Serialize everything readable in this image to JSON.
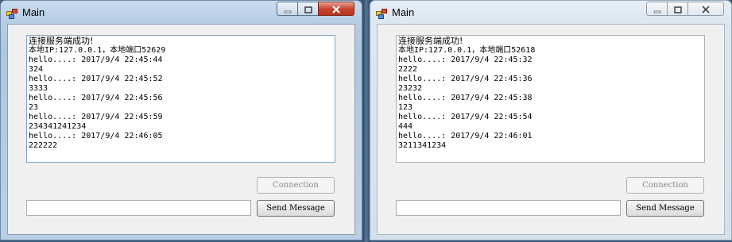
{
  "windows": [
    {
      "title": "Main",
      "log": {
        "header_lines": [
          "连接服务端成功!",
          "本地IP:127.0.0.1，本地端口52629"
        ],
        "messages": [
          {
            "time_line": "hello....: 2017/9/4 22:45:44",
            "body": "324"
          },
          {
            "time_line": "hello....: 2017/9/4 22:45:52",
            "body": "3333"
          },
          {
            "time_line": "hello....: 2017/9/4 22:45:56",
            "body": "23"
          },
          {
            "time_line": "hello....: 2017/9/4 22:45:59",
            "body": "234341241234"
          },
          {
            "time_line": "hello....: 2017/9/4 22:46:05",
            "body": "222222"
          }
        ]
      },
      "connection_button": "Connection",
      "send_button": "Send Message",
      "message_input": "",
      "active": true
    },
    {
      "title": "Main",
      "log": {
        "header_lines": [
          "连接服务端成功!",
          "本地IP:127.0.0.1，本地端口52618"
        ],
        "messages": [
          {
            "time_line": "hello....: 2017/9/4 22:45:32",
            "body": "2222"
          },
          {
            "time_line": "hello....: 2017/9/4 22:45:36",
            "body": "23232"
          },
          {
            "time_line": "hello....: 2017/9/4 22:45:38",
            "body": "123"
          },
          {
            "time_line": "hello....: 2017/9/4 22:45:54",
            "body": "444"
          },
          {
            "time_line": "hello....: 2017/9/4 22:46:01",
            "body": "3211341234"
          }
        ]
      },
      "connection_button": "Connection",
      "send_button": "Send Message",
      "message_input": "",
      "active": false
    }
  ],
  "icons": {
    "app": "app-window-icon",
    "minimize": "minimize-icon",
    "maximize": "maximize-icon",
    "close": "close-icon"
  }
}
